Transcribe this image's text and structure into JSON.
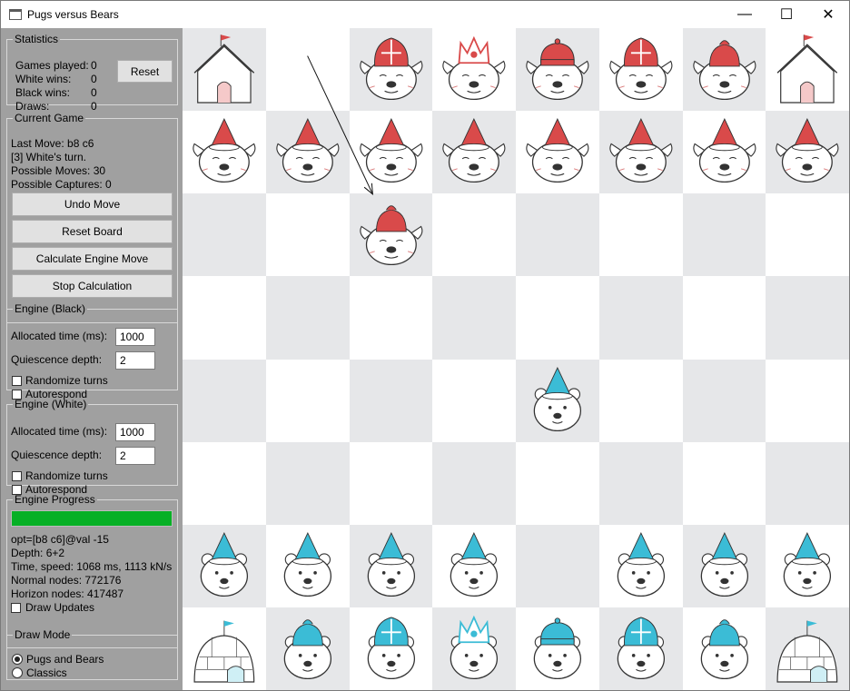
{
  "window": {
    "title": "Pugs versus Bears",
    "minimize_glyph": "—",
    "maximize_glyph": "☐",
    "close_glyph": "✕"
  },
  "statistics": {
    "legend": "Statistics",
    "games_played_label": "Games played:",
    "games_played": "0",
    "white_wins_label": "White wins:",
    "white_wins": "0",
    "black_wins_label": "Black wins:",
    "black_wins": "0",
    "draws_label": "Draws:",
    "draws": "0",
    "reset_label": "Reset"
  },
  "current_game": {
    "legend": "Current Game",
    "last_move": "Last Move: b8 c6",
    "turn": "[3] White's turn.",
    "possible_moves": "Possible Moves: 30",
    "possible_captures": "Possible Captures: 0",
    "undo_label": "Undo Move",
    "reset_board_label": "Reset Board",
    "calc_label": "Calculate Engine Move",
    "stop_label": "Stop Calculation"
  },
  "engine_black": {
    "legend": "Engine (Black)",
    "time_label": "Allocated time (ms):",
    "time_value": "1000",
    "depth_label": "Quiescence depth:",
    "depth_value": "2",
    "randomize_label": "Randomize turns",
    "randomize_checked": false,
    "autorespond_label": "Autorespond",
    "autorespond_checked": false
  },
  "engine_white": {
    "legend": "Engine (White)",
    "time_label": "Allocated time (ms):",
    "time_value": "1000",
    "depth_label": "Quiescence depth:",
    "depth_value": "2",
    "randomize_label": "Randomize turns",
    "randomize_checked": false,
    "autorespond_label": "Autorespond",
    "autorespond_checked": false
  },
  "engine_progress": {
    "legend": "Engine Progress",
    "progress_fraction": 1.0,
    "opt": "opt=[b8 c6]@val -15",
    "depth": "Depth: 6+2",
    "time_speed": "Time, speed: 1068 ms, 1113 kN/s",
    "normal_nodes": "Normal nodes: 772176",
    "horizon_nodes": "Horizon nodes: 417487",
    "draw_updates_label": "Draw Updates",
    "draw_updates_checked": false
  },
  "draw_mode": {
    "legend": "Draw Mode",
    "options": [
      "Pugs and Bears",
      "Classics"
    ],
    "selected": "Pugs and Bears"
  },
  "colors": {
    "sidebar_bg": "#a0a0a0",
    "light_square": "#ffffff",
    "dark_square": "#e6e7e9",
    "pug_red": "#d94a4a",
    "bear_blue": "#3bbcd6",
    "progress_green": "#06b025"
  },
  "board": {
    "rows": [
      [
        "pug-rook-doghouse",
        "",
        "pug-bishop-mitre",
        "pug-queen-crown",
        "pug-king-crown",
        "pug-bishop-mitre",
        "pug-knight-cap",
        "pug-rook-doghouse"
      ],
      [
        "pug-pawn-hat",
        "pug-pawn-hat",
        "pug-pawn-hat",
        "pug-pawn-hat",
        "pug-pawn-hat",
        "pug-pawn-hat",
        "pug-pawn-hat",
        "pug-pawn-hat"
      ],
      [
        "",
        "",
        "pug-knight-cap",
        "",
        "",
        "",
        "",
        ""
      ],
      [
        "",
        "",
        "",
        "",
        "",
        "",
        "",
        ""
      ],
      [
        "",
        "",
        "",
        "",
        "bear-pawn-hat",
        "",
        "",
        ""
      ],
      [
        "",
        "",
        "",
        "",
        "",
        "",
        "",
        ""
      ],
      [
        "bear-pawn-hat",
        "bear-pawn-hat",
        "bear-pawn-hat",
        "bear-pawn-hat",
        "",
        "bear-pawn-hat",
        "bear-pawn-hat",
        "bear-pawn-hat"
      ],
      [
        "bear-rook-igloo",
        "bear-knight-cap",
        "bear-bishop-mitre",
        "bear-queen-crown",
        "bear-king-crown",
        "bear-bishop-mitre",
        "bear-knight-cap",
        "bear-rook-igloo"
      ]
    ],
    "last_move_from": "b8",
    "last_move_to": "c6"
  }
}
